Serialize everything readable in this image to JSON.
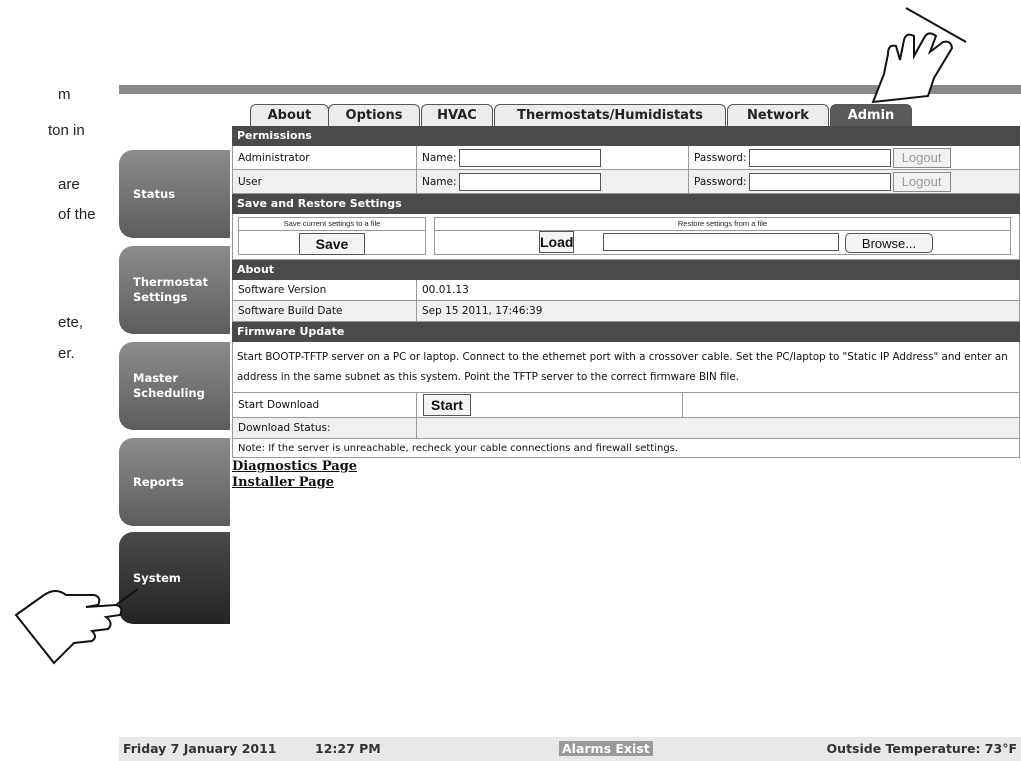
{
  "document": {
    "cut_lines": [
      "m",
      "ton in",
      "are",
      "of the",
      "ete,",
      "er."
    ]
  },
  "tabs": [
    "About",
    "Options",
    "HVAC",
    "Thermostats/Humidistats",
    "Network",
    "Admin"
  ],
  "sidebar": {
    "items": [
      {
        "label": "Status"
      },
      {
        "label": "Thermostat Settings"
      },
      {
        "label": "Master Scheduling"
      },
      {
        "label": "Reports"
      },
      {
        "label": "System"
      }
    ]
  },
  "permissions": {
    "title": "Permissions",
    "rows": [
      {
        "role": "Administrator",
        "name_label": "Name:",
        "password_label": "Password:",
        "logout": "Logout"
      },
      {
        "role": "User",
        "name_label": "Name:",
        "password_label": "Password:",
        "logout": "Logout"
      }
    ]
  },
  "save_restore": {
    "title": "Save and Restore Settings",
    "save_caption": "Save current settings to a file",
    "restore_caption": "Restore settings from a file",
    "save": "Save",
    "load": "Load",
    "browse": "Browse..."
  },
  "about": {
    "title": "About",
    "version_label": "Software Version",
    "version_value": "00.01.13",
    "build_label": "Software Build Date",
    "build_value": "Sep 15 2011, 17:46:39"
  },
  "firmware": {
    "title": "Firmware Update",
    "instructions": "Start BOOTP-TFTP server on a PC or laptop. Connect to the ethernet port with a crossover cable. Set the PC/laptop to \"Static IP Address\" and enter an address in the same subnet as this system. Point the TFTP server to the correct firmware BIN file.",
    "start_download_label": "Start Download",
    "start": "Start",
    "status_label": "Download Status:",
    "note": "Note: If the server is unreachable, recheck your cable connections and firewall settings."
  },
  "links": {
    "diagnostics": "Diagnostics Page",
    "installer": "Installer Page"
  },
  "footer": {
    "date": "Friday  7 January 2011",
    "time": "12:27 PM",
    "alarm": "Alarms Exist",
    "outside": "Outside Temperature: 73°F"
  }
}
